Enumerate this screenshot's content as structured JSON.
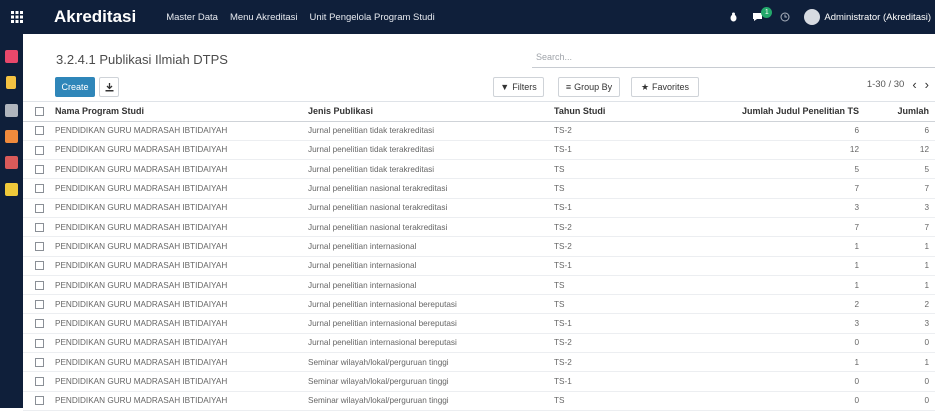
{
  "topbar": {
    "app_title": "Akreditasi",
    "menus": [
      "Master Data",
      "Menu Akreditasi",
      "Unit Pengelola Program Studi"
    ],
    "chat_count": "1",
    "user": "Administrator (Akreditasi)"
  },
  "sidebar": {
    "icons": [
      {
        "name": "discuss-icon",
        "color": "#e8486b"
      },
      {
        "name": "notes-icon",
        "color": "#f4c242"
      },
      {
        "name": "link-icon",
        "color": "#b0b5bd"
      },
      {
        "name": "document-icon",
        "color": "#f08a3c"
      },
      {
        "name": "users-icon",
        "color": "#d95a5a"
      },
      {
        "name": "settings-icon",
        "color": "#f0c93a"
      }
    ]
  },
  "page": {
    "breadcrumb": "3.2.4.1 Publikasi Ilmiah DTPS",
    "search_placeholder": "Search...",
    "create_label": "Create",
    "filters_label": "Filters",
    "group_by_label": "Group By",
    "favorites_label": "Favorites",
    "pager_text": "1-30 / 30"
  },
  "table": {
    "headers": [
      "Nama Program Studi",
      "Jenis Publikasi",
      "Tahun Studi",
      "Jumlah Judul Penelitian TS",
      "Jumlah"
    ],
    "rows": [
      [
        "PENDIDIKAN GURU MADRASAH IBTIDAIYAH",
        "Jurnal penelitian tidak terakreditasi",
        "TS-2",
        "6",
        "6"
      ],
      [
        "PENDIDIKAN GURU MADRASAH IBTIDAIYAH",
        "Jurnal penelitian tidak terakreditasi",
        "TS-1",
        "12",
        "12"
      ],
      [
        "PENDIDIKAN GURU MADRASAH IBTIDAIYAH",
        "Jurnal penelitian tidak terakreditasi",
        "TS",
        "5",
        "5"
      ],
      [
        "PENDIDIKAN GURU MADRASAH IBTIDAIYAH",
        "Jurnal penelitian nasional terakreditasi",
        "TS",
        "7",
        "7"
      ],
      [
        "PENDIDIKAN GURU MADRASAH IBTIDAIYAH",
        "Jurnal penelitian nasional terakreditasi",
        "TS-1",
        "3",
        "3"
      ],
      [
        "PENDIDIKAN GURU MADRASAH IBTIDAIYAH",
        "Jurnal penelitian nasional terakreditasi",
        "TS-2",
        "7",
        "7"
      ],
      [
        "PENDIDIKAN GURU MADRASAH IBTIDAIYAH",
        "Jurnal penelitian internasional",
        "TS-2",
        "1",
        "1"
      ],
      [
        "PENDIDIKAN GURU MADRASAH IBTIDAIYAH",
        "Jurnal penelitian internasional",
        "TS-1",
        "1",
        "1"
      ],
      [
        "PENDIDIKAN GURU MADRASAH IBTIDAIYAH",
        "Jurnal penelitian internasional",
        "TS",
        "1",
        "1"
      ],
      [
        "PENDIDIKAN GURU MADRASAH IBTIDAIYAH",
        "Jurnal penelitian internasional bereputasi",
        "TS",
        "2",
        "2"
      ],
      [
        "PENDIDIKAN GURU MADRASAH IBTIDAIYAH",
        "Jurnal penelitian internasional bereputasi",
        "TS-1",
        "3",
        "3"
      ],
      [
        "PENDIDIKAN GURU MADRASAH IBTIDAIYAH",
        "Jurnal penelitian internasional bereputasi",
        "TS-2",
        "0",
        "0"
      ],
      [
        "PENDIDIKAN GURU MADRASAH IBTIDAIYAH",
        "Seminar wilayah/lokal/perguruan tinggi",
        "TS-2",
        "1",
        "1"
      ],
      [
        "PENDIDIKAN GURU MADRASAH IBTIDAIYAH",
        "Seminar wilayah/lokal/perguruan tinggi",
        "TS-1",
        "0",
        "0"
      ],
      [
        "PENDIDIKAN GURU MADRASAH IBTIDAIYAH",
        "Seminar wilayah/lokal/perguruan tinggi",
        "TS",
        "0",
        "0"
      ]
    ]
  }
}
